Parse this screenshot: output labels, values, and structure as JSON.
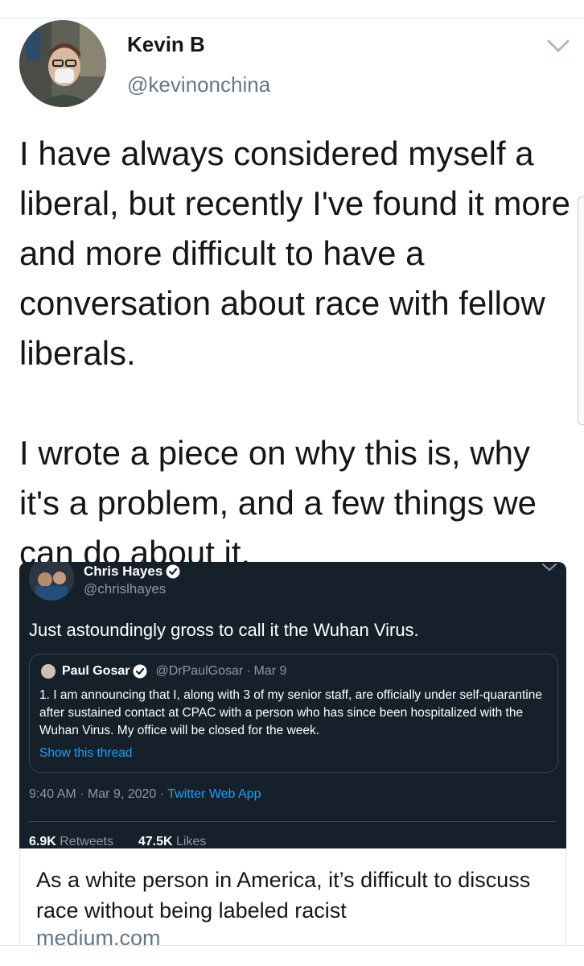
{
  "tweet": {
    "author_name": "Kevin B",
    "author_handle": "@kevinonchina",
    "text_paragraphs": [
      "I have always considered myself a liberal, but recently I've found it more and more difficult to have a conversation about race with fellow liberals.",
      "I wrote a piece on why this is, why it's a problem, and a few things we can do about it."
    ]
  },
  "embedded_tweet": {
    "author_name": "Chris Hayes",
    "author_handle": "@chrislhayes",
    "text": "Just astoundingly gross to call it the Wuhan Virus.",
    "quoted": {
      "author_name": "Paul Gosar",
      "author_handle": "@DrPaulGosar",
      "date": "Mar 9",
      "text": "1. I am announcing that I, along with 3 of my senior staff, are officially under self-quarantine after sustained contact at CPAC with a person who has since been hospitalized with the Wuhan Virus.  My office will be closed for the week.",
      "show_thread_label": "Show this thread"
    },
    "time": "9:40 AM",
    "date": "Mar 9, 2020",
    "source": "Twitter Web App",
    "retweets_count": "6.9K",
    "retweets_label": "Retweets",
    "likes_count": "47.5K",
    "likes_label": "Likes"
  },
  "link_card": {
    "title": "As a white person in America, it’s difficult to discuss race without being labeled racist",
    "domain": "medium.com"
  },
  "colors": {
    "link_blue": "#1da1f2",
    "dark_card_bg": "#15202b",
    "secondary_text": "#657786"
  },
  "icons": [
    "chevron-down-icon",
    "verified-badge-icon"
  ]
}
